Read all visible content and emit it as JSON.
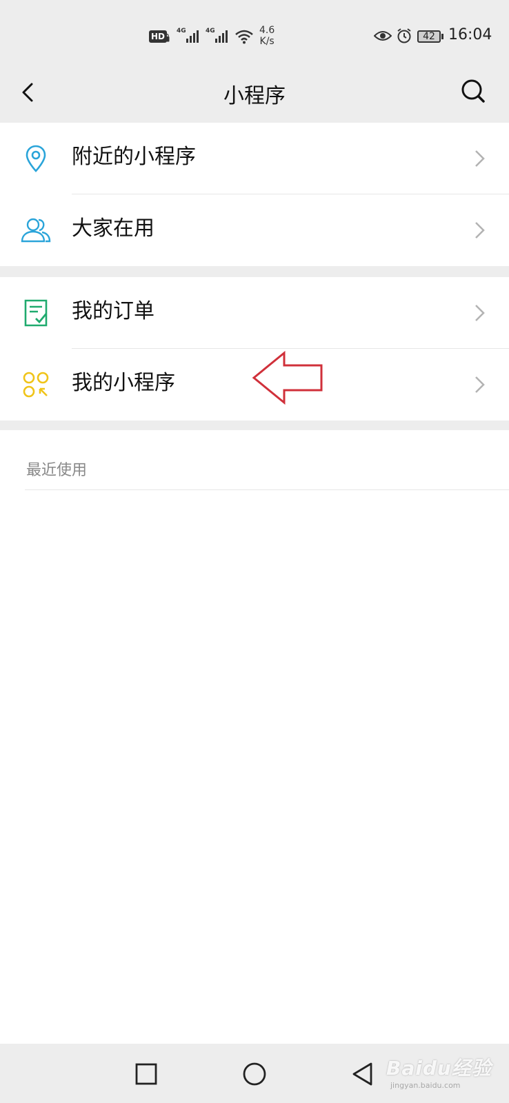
{
  "status_bar": {
    "hd_label": "HD",
    "network_1": "4G",
    "network_2": "4G",
    "speed_value": "4.6",
    "speed_unit": "K/s",
    "battery_level": "42",
    "time": "16:04"
  },
  "nav": {
    "title": "小程序",
    "back_icon": "chevron-left-icon",
    "search_icon": "search-icon"
  },
  "groups": [
    {
      "items": [
        {
          "label": "附近的小程序",
          "icon": "location-pin-icon",
          "icon_color": "#2aa4d9"
        },
        {
          "label": "大家在用",
          "icon": "users-icon",
          "icon_color": "#2aa4d9"
        }
      ]
    },
    {
      "items": [
        {
          "label": "我的订单",
          "icon": "order-check-icon",
          "icon_color": "#1faa6e"
        },
        {
          "label": "我的小程序",
          "icon": "my-apps-icon",
          "icon_color": "#f0c419"
        }
      ]
    }
  ],
  "recent": {
    "label": "最近使用"
  },
  "annotation": {
    "color": "#d0303a"
  },
  "system_nav": {
    "recents_icon": "square-icon",
    "home_icon": "circle-icon",
    "back_icon": "triangle-back-icon"
  },
  "watermark": {
    "text": "Baidu经验",
    "sub": "jingyan.baidu.com"
  }
}
